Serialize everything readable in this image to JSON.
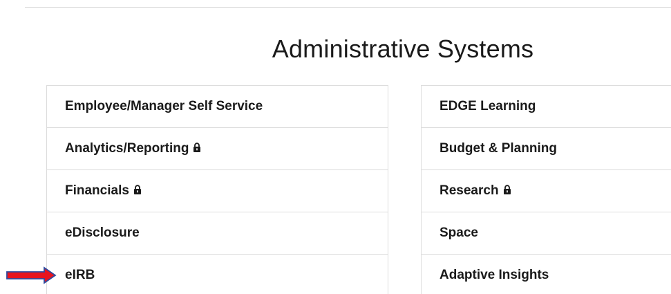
{
  "heading": "Administrative Systems",
  "left_column": {
    "items": [
      {
        "label": "Employee/Manager Self Service",
        "locked": false
      },
      {
        "label": "Analytics/Reporting",
        "locked": true
      },
      {
        "label": "Financials",
        "locked": true
      },
      {
        "label": "eDisclosure",
        "locked": false
      },
      {
        "label": "eIRB",
        "locked": false
      }
    ]
  },
  "right_column": {
    "items": [
      {
        "label": "EDGE Learning",
        "locked": false
      },
      {
        "label": "Budget & Planning",
        "locked": false
      },
      {
        "label": "Research",
        "locked": true
      },
      {
        "label": "Space",
        "locked": false
      },
      {
        "label": "Adaptive Insights",
        "locked": false
      }
    ]
  },
  "annotation": {
    "arrow_color": "#e8141e",
    "arrow_outline_color": "#2f4a9e",
    "points_to": "eIRB"
  },
  "icons": {
    "lock": "lock-icon",
    "arrow": "arrow-right-icon"
  }
}
